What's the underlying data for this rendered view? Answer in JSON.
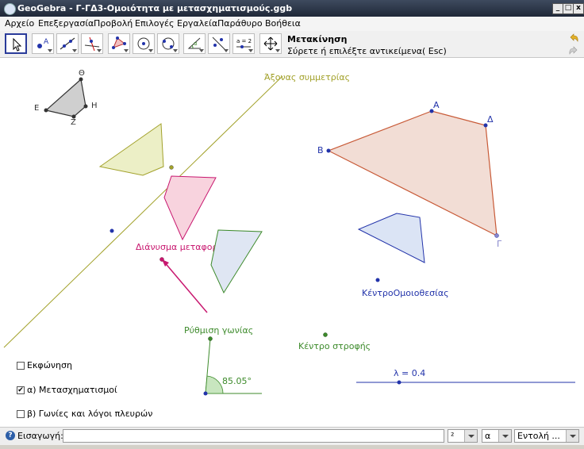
{
  "window": {
    "title": "GeoGebra - Γ-ΓΔ3-Ομοιότητα με μετασχηματισμούς.ggb",
    "btn_min": "_",
    "btn_max": "□",
    "btn_close": "x"
  },
  "menu": [
    "Αρχείο",
    "Επεξεργασία",
    "Προβολή",
    "Επιλογές",
    "Εργαλεία",
    "Παράθυρο",
    "Βοήθεια"
  ],
  "toolbar": {
    "tool_name": "Μετακίνηση",
    "tool_help": "Σύρετε ή επιλέξτε αντικείμενα( Esc)",
    "slider_tool_label": "a = 2",
    "tools": [
      "move-tool",
      "point-tool",
      "line-tool",
      "perpendicular-tool",
      "polygon-tool",
      "circle-tool",
      "conic-tool",
      "angle-tool",
      "reflect-tool",
      "slider-tool",
      "move-view-tool"
    ]
  },
  "canvas": {
    "label_axis": "Άξονας συμμετρίας",
    "label_vector": "Διάνυσμα μεταφοράς",
    "label_angle_setting": "Ρύθμιση γωνίας",
    "label_rotation_center": "Κέντρο στροφής",
    "label_homothety_center": "ΚέντροΟμοιοθεσίας",
    "label_slider": "λ = 0.4",
    "angle_value": "85.05°",
    "vertex_theta": "Θ",
    "vertex_e": "Ε",
    "vertex_h": "Η",
    "vertex_z": "Ζ",
    "vertex_a": "Α",
    "vertex_b": "Β",
    "vertex_g": "Γ",
    "vertex_d": "Δ",
    "colors": {
      "olive": "#a2a12a",
      "pink": "#c8176f",
      "green": "#3c8a2a",
      "blue": "#2233aa",
      "brown_edge": "#c85a37"
    }
  },
  "checkboxes": [
    {
      "label": "Εκφώνηση",
      "checked": false,
      "mark": ""
    },
    {
      "label": "α) Μετασχηματισμοί",
      "checked": true,
      "mark": "✔"
    },
    {
      "label": "β) Γωνίες και λόγοι πλευρών",
      "checked": false,
      "mark": ""
    }
  ],
  "inputbar": {
    "label": "Εισαγωγή:",
    "value": "",
    "combo1": "²",
    "combo2": "α",
    "combo3": "Εντολή ..."
  }
}
